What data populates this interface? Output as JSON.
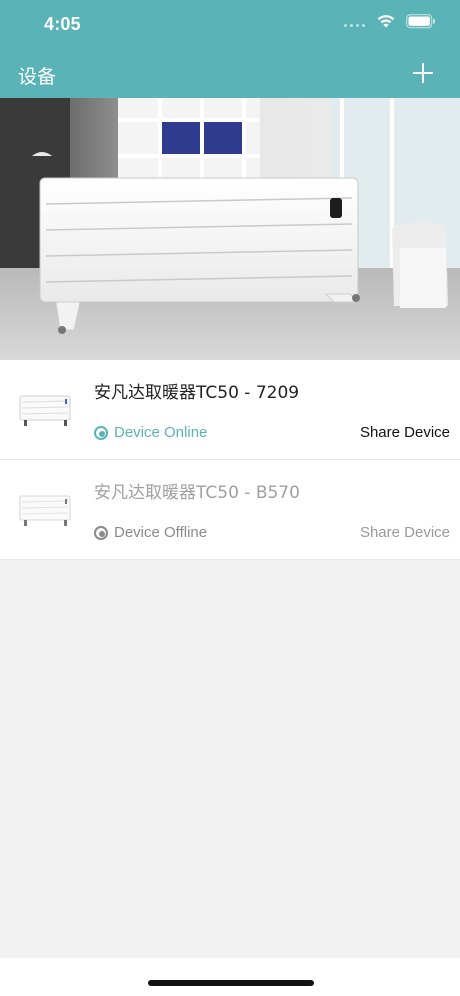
{
  "status_bar": {
    "time": "4:05"
  },
  "nav": {
    "title": "设备"
  },
  "banner": {
    "page_count": 3,
    "active_page": 1
  },
  "devices": [
    {
      "name": "安凡达取暖器TC50 - 7209",
      "status": "Device Online",
      "share_label": "Share Device"
    },
    {
      "name": "安凡达取暖器TC50 - B570",
      "status": "Device Offline",
      "share_label": "Share Device"
    }
  ],
  "colors": {
    "accent": "#5ab3b7",
    "offline": "#8a8a8a"
  }
}
